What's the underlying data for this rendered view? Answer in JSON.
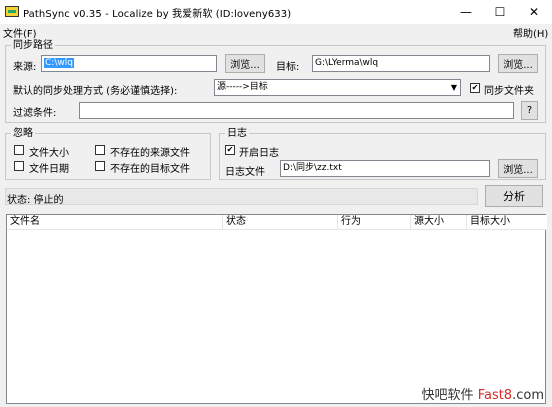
{
  "window": {
    "title": "PathSync v0.35 - Localize by 我爱新软 (ID:loveny633)",
    "minimize": "—",
    "maximize": "☐",
    "close": "✕"
  },
  "menu": {
    "file": "文件(F)",
    "help": "帮助(H)"
  },
  "sync_group": {
    "title": "同步路径",
    "source_label": "来源:",
    "source_value": "C:\\wlq",
    "browse1": "浏览...",
    "target_label": "目标:",
    "target_value": "G:\\LYerma\\wlq",
    "browse2": "浏览...",
    "mode_label": "默认的同步处理方式 (务必谨慎选择):",
    "mode_value": "源----->目标",
    "sync_files_label": "同步文件夹",
    "sync_files_checked": true,
    "filter_label": "过滤条件:",
    "filter_value": "",
    "help_button": "?"
  },
  "ignore_group": {
    "title": "忽略",
    "file_size": "文件大小",
    "file_date": "文件日期",
    "missing_source": "不存在的来源文件",
    "missing_target": "不存在的目标文件"
  },
  "log_group": {
    "title": "日志",
    "enable_log": "开启日志",
    "enable_log_checked": true,
    "log_file_label": "日志文件",
    "log_file_value": "D:\\同步\\zz.txt",
    "browse3": "浏览..."
  },
  "status": {
    "text": "状态: 停止的",
    "analyze_button": "分析"
  },
  "list": {
    "columns": [
      "文件名",
      "状态",
      "行为",
      "源大小",
      "目标大小"
    ]
  },
  "watermark": {
    "text1": "快吧软件 ",
    "text2": "Fast8",
    "text3": ".com"
  }
}
